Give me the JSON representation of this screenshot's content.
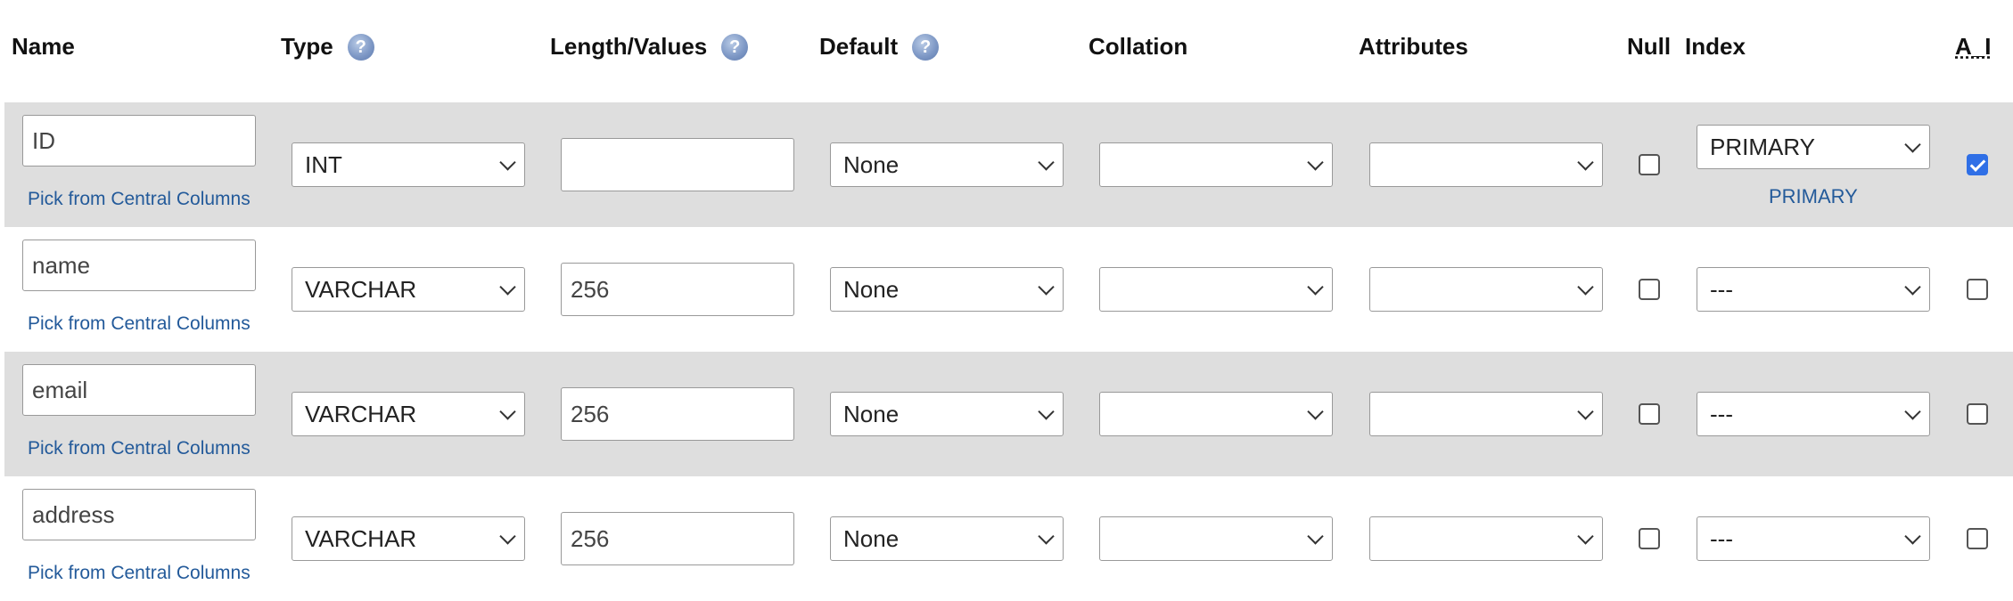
{
  "headers": {
    "name": "Name",
    "type": "Type",
    "length": "Length/Values",
    "default": "Default",
    "collation": "Collation",
    "attributes": "Attributes",
    "null": "Null",
    "index": "Index",
    "ai": "A_I"
  },
  "icons": {
    "help": "help-question-icon",
    "dropdown": "chevron-down-icon"
  },
  "colors": {
    "row_shade": "#dedede",
    "link": "#235a9a",
    "checkbox_checked": "#2f6fe6",
    "help_icon": "#7f99c6"
  },
  "pick_label": "Pick from Central Columns",
  "rows": [
    {
      "name": "ID",
      "type": "INT",
      "length": "",
      "default": "None",
      "collation": "",
      "attributes": "",
      "null": false,
      "index": "PRIMARY",
      "index_label": "PRIMARY",
      "ai": true
    },
    {
      "name": "name",
      "type": "VARCHAR",
      "length": "256",
      "default": "None",
      "collation": "",
      "attributes": "",
      "null": false,
      "index": "---",
      "index_label": "",
      "ai": false
    },
    {
      "name": "email",
      "type": "VARCHAR",
      "length": "256",
      "default": "None",
      "collation": "",
      "attributes": "",
      "null": false,
      "index": "---",
      "index_label": "",
      "ai": false
    },
    {
      "name": "address",
      "type": "VARCHAR",
      "length": "256",
      "default": "None",
      "collation": "",
      "attributes": "",
      "null": false,
      "index": "---",
      "index_label": "",
      "ai": false
    }
  ]
}
